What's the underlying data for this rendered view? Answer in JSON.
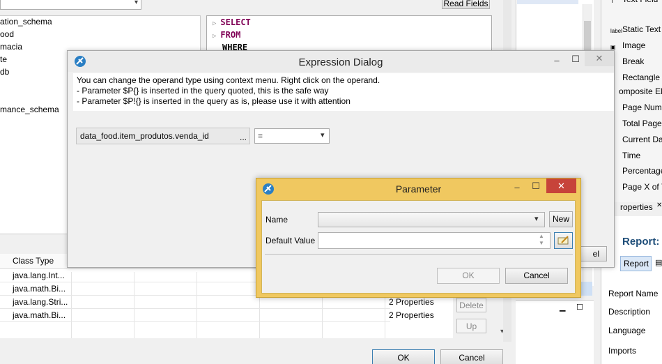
{
  "background": {
    "read_fields_label": "Read Fields",
    "tree_items": [
      "ation_schema",
      "ood",
      "macia",
      "te",
      "db",
      "mance_schema"
    ],
    "sql_lines": [
      "SELECT",
      "FROM",
      "WHERE"
    ],
    "grid": {
      "header": "Class Type",
      "rows": [
        {
          "type": "java.lang.Int...",
          "props": ""
        },
        {
          "type": "java.math.Bi...",
          "props": ""
        },
        {
          "type": "java.lang.Stri...",
          "props": "2 Properties"
        },
        {
          "type": "java.math.Bi...",
          "props": "2 Properties"
        }
      ],
      "delete_label": "Delete",
      "up_label": "Up"
    },
    "ok_label": "OK",
    "cancel_label": "Cancel",
    "cancel_partial": "el"
  },
  "palette": {
    "items": [
      {
        "label": "Text Field",
        "icon": "text-field-icon",
        "glyph": "T"
      },
      {
        "label": "Static Text",
        "icon": "static-text-icon",
        "glyph": "label"
      },
      {
        "label": "Image",
        "icon": "image-icon",
        "glyph": "▣"
      },
      {
        "label": "Break",
        "icon": "break-icon",
        "glyph": ""
      },
      {
        "label": "Rectangle",
        "icon": "rectangle-icon",
        "glyph": ""
      },
      {
        "label": "omposite El",
        "icon": "",
        "glyph": ""
      },
      {
        "label": "Page Num",
        "icon": "page-number-icon",
        "glyph": ""
      },
      {
        "label": "Total Page",
        "icon": "total-pages-icon",
        "glyph": ""
      },
      {
        "label": "Current Da",
        "icon": "current-date-icon",
        "glyph": ""
      },
      {
        "label": "Time",
        "icon": "time-icon",
        "glyph": ""
      },
      {
        "label": "Percentage",
        "icon": "percentage-icon",
        "glyph": ""
      },
      {
        "label": "Page X of Y",
        "icon": "page-x-of-y-icon",
        "glyph": ""
      }
    ]
  },
  "properties": {
    "tab_label": "roperties",
    "title": "Report:",
    "report_tab": "Report",
    "labels": [
      "Report Name",
      "Description",
      "Language",
      "Imports"
    ]
  },
  "expression_dialog": {
    "title": "Expression Dialog",
    "info_lines": [
      "You can change the operand type using context menu. Right click on the operand.",
      "- Parameter $P{} is inserted in the query quoted, this is the safe way",
      "- Parameter $P!{} is inserted in the query as is, please use it with attention"
    ],
    "operand": "data_food.item_produtos.venda_id",
    "ellipsis": "...",
    "operator": "="
  },
  "parameter_dialog": {
    "title": "Parameter",
    "name_label": "Name",
    "name_value": "",
    "new_label": "New",
    "default_value_label": "Default Value",
    "default_value": "",
    "ok_label": "OK",
    "cancel_label": "Cancel"
  },
  "colors": {
    "active_title": "#f0c860",
    "close_red": "#c7433a",
    "sql_keyword": "#7f0055"
  }
}
